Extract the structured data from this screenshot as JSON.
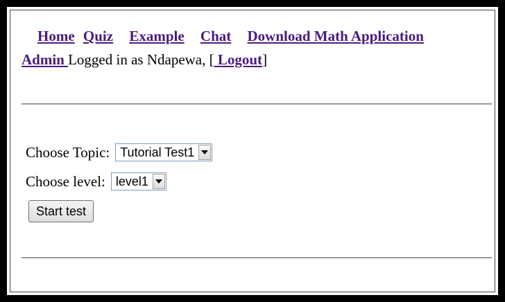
{
  "nav": {
    "links": [
      "Home",
      "Quiz",
      "Example",
      "Chat",
      "Download Math Application"
    ],
    "admin_label": "Admin "
  },
  "login": {
    "text": " Logged in as Ndapewa, [",
    "logout_label": " Logout",
    "close_bracket": "]"
  },
  "form": {
    "topic_label": "Choose Topic:",
    "topic_value": "Tutorial Test1",
    "level_label": "Choose level:",
    "level_value": "level1",
    "start_label": "Start test"
  }
}
